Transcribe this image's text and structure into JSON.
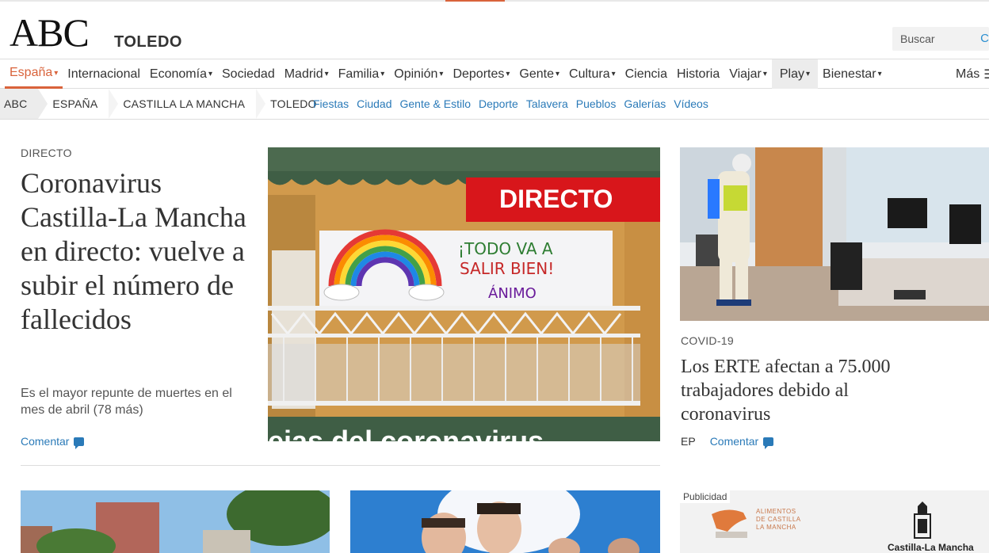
{
  "masthead": {
    "logo": "ABC",
    "section": "TOLEDO",
    "search_placeholder": "Buscar",
    "search_icon": "search-icon"
  },
  "nav": {
    "items": [
      {
        "label": "España",
        "caret": "▾"
      },
      {
        "label": "Internacional",
        "caret": ""
      },
      {
        "label": "Economía",
        "caret": "▾"
      },
      {
        "label": "Sociedad",
        "caret": ""
      },
      {
        "label": "Madrid",
        "caret": "▾"
      },
      {
        "label": "Familia",
        "caret": "▾"
      },
      {
        "label": "Opinión",
        "caret": "▾"
      },
      {
        "label": "Deportes",
        "caret": "▾"
      },
      {
        "label": "Gente",
        "caret": "▾"
      },
      {
        "label": "Cultura",
        "caret": "▾"
      },
      {
        "label": "Ciencia",
        "caret": ""
      },
      {
        "label": "Historia",
        "caret": ""
      },
      {
        "label": "Viajar",
        "caret": "▾"
      },
      {
        "label": "Play",
        "caret": "▾"
      },
      {
        "label": "Bienestar",
        "caret": "▾"
      }
    ],
    "more": "Más",
    "active_color": "#d9633b"
  },
  "breadcrumb": [
    "ABC",
    "ESPAÑA",
    "CASTILLA LA MANCHA",
    "TOLEDO"
  ],
  "sublinks": [
    "Fiestas",
    "Ciudad",
    "Gente & Estilo",
    "Deporte",
    "Talavera",
    "Pueblos",
    "Galerías",
    "Vídeos"
  ],
  "lead": {
    "kicker": "DIRECTO",
    "title": "Coronavirus Castilla-La Mancha en directo: vuelve a subir el número de fallecidos",
    "summary": "Es el mayor repunte de muertes en el mes de abril (78 más)",
    "comment": "Comentar",
    "image": {
      "badge": "DIRECTO",
      "banner_line1": "¡TODO VA A",
      "banner_line2": "SALIR BIEN!",
      "banner_line3": "ÁNIMO",
      "caption": "ejas del coronavirus"
    }
  },
  "secondary": {
    "kicker": "COVID-19",
    "title": "Los ERTE afectan a 75.000 trabajadores debido al coronavirus",
    "source": "EP",
    "comment": "Comentar"
  },
  "ad": {
    "label": "Publicidad",
    "brand1_l1": "ALIMENTOS",
    "brand1_l2": "DE CASTILLA",
    "brand1_l3": "LA MANCHA",
    "brand2": "Castilla-La Mancha"
  },
  "colors": {
    "link": "#2a7ab8",
    "accent": "#d9633b",
    "badge_red": "#d8161b"
  }
}
